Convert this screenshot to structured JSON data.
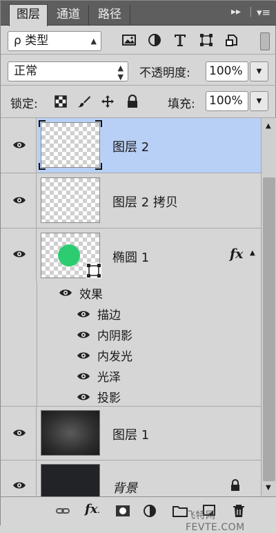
{
  "tabs": [
    {
      "label": "图层",
      "active": true
    },
    {
      "label": "通道",
      "active": false
    },
    {
      "label": "路径",
      "active": false
    }
  ],
  "filter": {
    "kind_label": "ρ 类型"
  },
  "blend": {
    "mode": "正常",
    "opacity_label": "不透明度:",
    "opacity_value": "100%"
  },
  "lock": {
    "label": "锁定:",
    "fill_label": "填充:",
    "fill_value": "100%"
  },
  "layers": [
    {
      "name": "图层 2",
      "selected": true
    },
    {
      "name": "图层 2 拷贝",
      "selected": false
    },
    {
      "name": "椭圆 1",
      "fx": "fx",
      "effects_label": "效果",
      "effects": [
        "描边",
        "内阴影",
        "内发光",
        "光泽",
        "投影"
      ]
    },
    {
      "name": "图层 1"
    },
    {
      "name": "背景",
      "locked": true
    }
  ],
  "colors": {
    "selected_row": "#b9d0f6",
    "shape_fill": "#2ecc71"
  },
  "watermark": "飞特网 FEVTE.COM"
}
